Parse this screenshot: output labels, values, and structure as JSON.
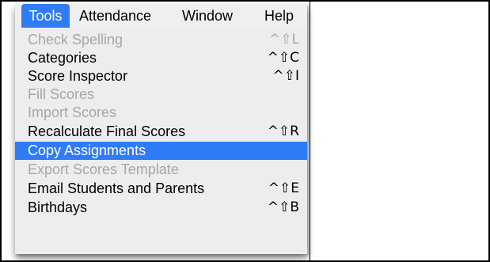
{
  "colors": {
    "highlight": "#2f7cf6",
    "menu_background": "#ededed",
    "disabled_text": "#a7a7a7",
    "enabled_text": "#000000"
  },
  "menubar": {
    "items": [
      {
        "label": "Tools",
        "active": true
      },
      {
        "label": "Attendance",
        "active": false
      },
      {
        "label": "Window",
        "active": false
      },
      {
        "label": "Help",
        "active": false
      }
    ]
  },
  "menu": {
    "items": [
      {
        "label": "Check Spelling",
        "shortcut": "^⇧L",
        "state": "disabled"
      },
      {
        "label": "Categories",
        "shortcut": "^⇧C",
        "state": "enabled"
      },
      {
        "label": "Score Inspector",
        "shortcut": "^⇧I",
        "state": "enabled"
      },
      {
        "label": "Fill Scores",
        "shortcut": "",
        "state": "disabled"
      },
      {
        "label": "Import Scores",
        "shortcut": "",
        "state": "disabled"
      },
      {
        "label": "Recalculate Final Scores",
        "shortcut": "^⇧R",
        "state": "enabled"
      },
      {
        "label": "Copy Assignments",
        "shortcut": "",
        "state": "highlighted"
      },
      {
        "label": "Export Scores Template",
        "shortcut": "",
        "state": "disabled"
      },
      {
        "label": "Email Students and Parents",
        "shortcut": "^⇧E",
        "state": "enabled"
      },
      {
        "label": "Birthdays",
        "shortcut": "^⇧B",
        "state": "enabled"
      }
    ]
  }
}
